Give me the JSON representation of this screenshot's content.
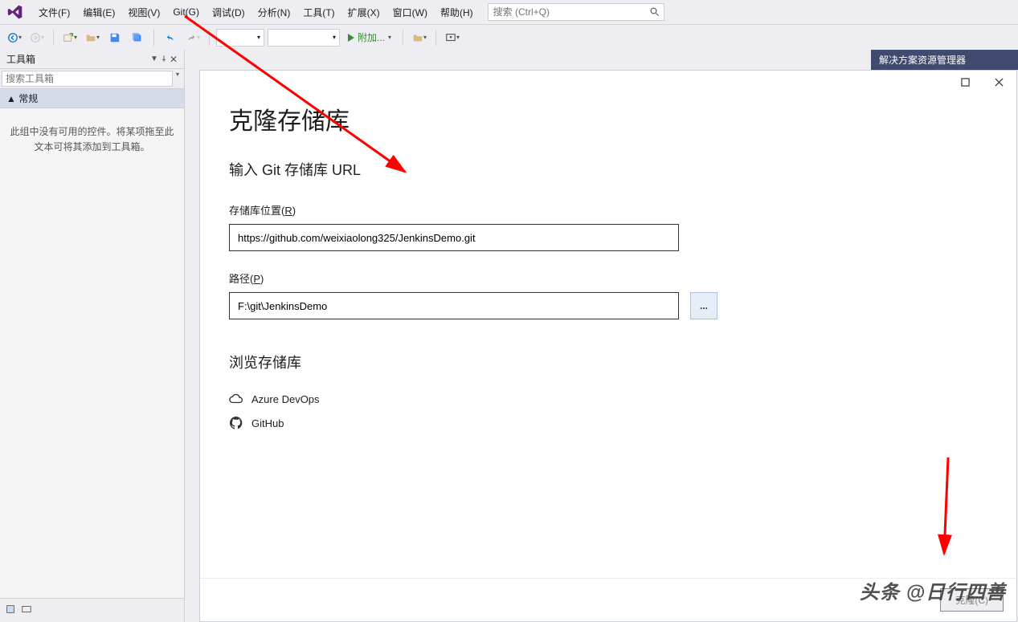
{
  "menubar": {
    "items": [
      "文件(F)",
      "编辑(E)",
      "视图(V)",
      "Git(G)",
      "调试(D)",
      "分析(N)",
      "工具(T)",
      "扩展(X)",
      "窗口(W)",
      "帮助(H)"
    ],
    "search_placeholder": "搜索 (Ctrl+Q)"
  },
  "toolbar": {
    "attach_label": "附加..."
  },
  "toolbox": {
    "title": "工具箱",
    "search_placeholder": "搜索工具箱",
    "section_general": "▲ 常规",
    "empty_text": "此组中没有可用的控件。将某项拖至此文本可将其添加到工具箱。"
  },
  "solution_explorer": {
    "title": "解决方案资源管理器"
  },
  "clone": {
    "title": "克隆存储库",
    "subtitle": "输入 Git 存储库 URL",
    "location_label_pre": "存储库位置(",
    "location_label_key": "R",
    "location_label_post": ")",
    "location_value": "https://github.com/weixiaolong325/JenkinsDemo.git",
    "path_label_pre": "路径(",
    "path_label_key": "P",
    "path_label_post": ")",
    "path_value": "F:\\git\\JenkinsDemo",
    "browse_btn": "...",
    "browse_title": "浏览存储库",
    "provider_azure": "Azure DevOps",
    "provider_github": "GitHub",
    "clone_btn": "克隆(C)"
  },
  "watermark": "头条 @日行四善"
}
